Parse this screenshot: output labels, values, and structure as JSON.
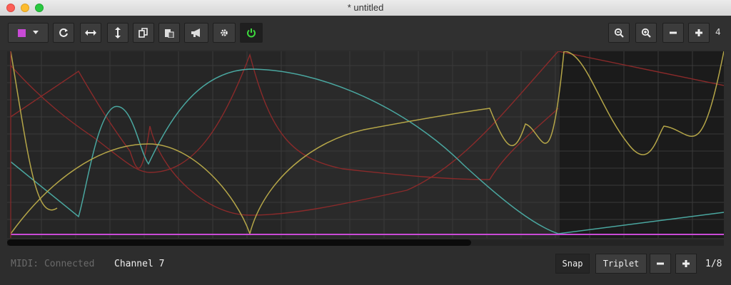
{
  "window": {
    "title": "* untitled"
  },
  "toolbar": {
    "color_swatch": "#c94ad6",
    "power_color": "#3ddc3d",
    "zoom_level": "4",
    "buttons": [
      {
        "icon": "refresh-icon"
      },
      {
        "icon": "horizontal-arrows-icon"
      },
      {
        "icon": "vertical-arrows-icon"
      },
      {
        "icon": "copy-icon"
      },
      {
        "icon": "paste-icon"
      },
      {
        "icon": "megaphone-icon"
      },
      {
        "icon": "gear-icon"
      },
      {
        "icon": "power-icon"
      }
    ]
  },
  "status": {
    "midi": "MIDI: Connected",
    "channel": "Channel 7",
    "snap": "Snap",
    "triplet": "Triplet",
    "fraction": "1/8"
  },
  "colors": {
    "baseline": "#c94ad6",
    "teal": "#4aa7a0",
    "gold": "#b5a648",
    "red": "#8a2a2a"
  }
}
